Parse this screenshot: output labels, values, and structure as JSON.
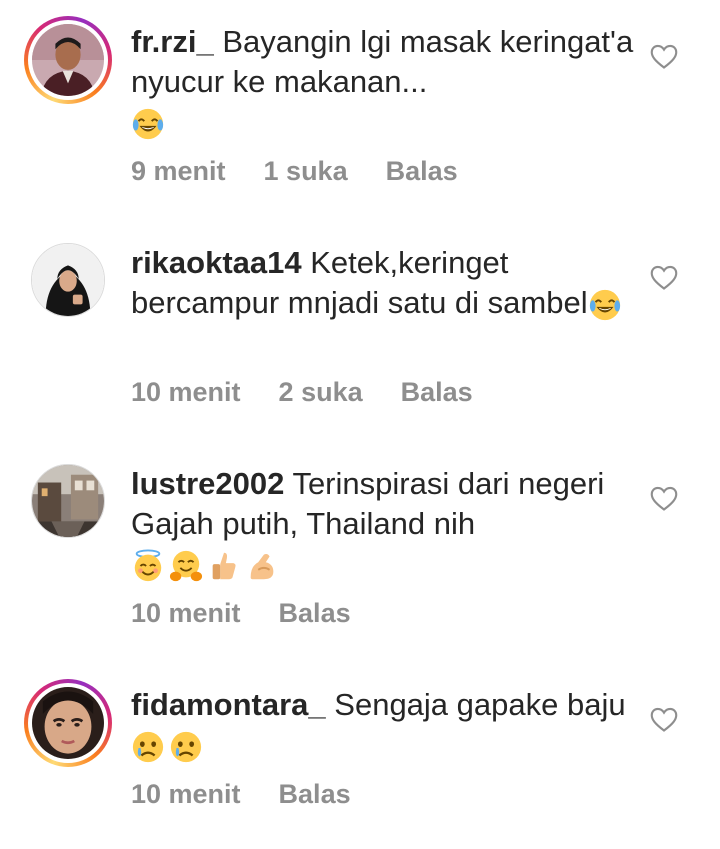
{
  "comments": [
    {
      "username": "fr.rzi_",
      "text": " Bayangin lgi masak keringat'a nyucur ke makanan...",
      "emojis": [
        "tears-of-joy"
      ],
      "time": "9 menit",
      "likes": "1 suka",
      "reply": "Balas",
      "has_story": true
    },
    {
      "username": "rikaoktaa14",
      "text": " Ketek,keringet bercampur mnjadi satu di sambel",
      "emojis": [
        "tears-of-joy"
      ],
      "time": "10 menit",
      "likes": "2 suka",
      "reply": "Balas",
      "has_story": false
    },
    {
      "username": "lustre2002",
      "text": " Terinspirasi dari negeri Gajah putih, Thailand nih",
      "emojis": [
        "smiling-face-with-halo",
        "hugging-face",
        "thumbs-up",
        "flexed-biceps"
      ],
      "time": "10 menit",
      "likes": "",
      "reply": "Balas",
      "has_story": false
    },
    {
      "username": "fidamontara_",
      "text": " Sengaja gapake baju ",
      "emojis": [
        "crying-face",
        "crying-face"
      ],
      "time": "10 menit",
      "likes": "",
      "reply": "Balas",
      "has_story": true
    }
  ],
  "icons": {
    "like": "heart-outline-icon"
  },
  "colors": {
    "text": "#262626",
    "meta": "#8e8e8e",
    "heart": "#8e8e8e"
  }
}
